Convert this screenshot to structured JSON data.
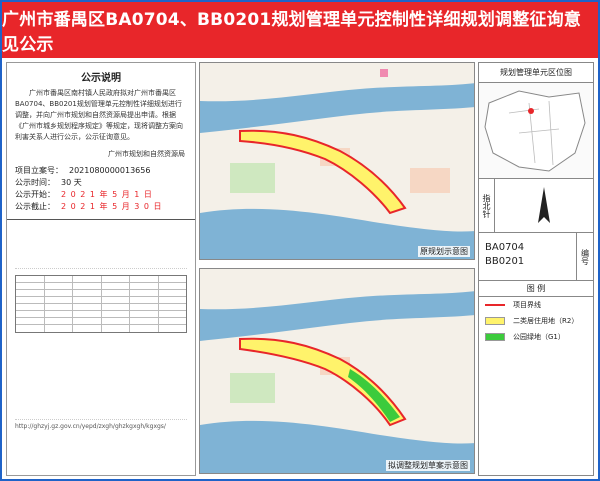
{
  "title": "广州市番禺区BA0704、BB0201规划管理单元控制性详细规划调整征询意见公示",
  "left": {
    "section_title": "公示说明",
    "notice": "广州市番禺区南村镇人民政府拟对广州市番禺区BA0704、BB0201规划管理单元控制性详细规划进行调整，并向广州市规划和自然资源局提出申请。根据《广州市城乡规划程序规定》等规定，现将调整方案向利害关系人进行公示，公示征询意见。",
    "org": "广州市规划和自然资源局",
    "project_no_label": "项目立案号：",
    "project_no": "2021080000013656",
    "period_label": "公示时间：",
    "period": "30 天",
    "start_label": "公示开始：",
    "start": "2 0 2 1 年 5 月 1 日",
    "end_label": "公示截止：",
    "end": "2 0 2 1 年 5 月 3 0 日",
    "url": "http://ghzyj.gz.gov.cn/yepd/zxgh/ghzkgxgh/kgxgs/"
  },
  "maps": {
    "top_caption": "原规划示意图",
    "bottom_caption": "拟调整规划草案示意图"
  },
  "right": {
    "location_title": "规划管理单元区位图",
    "compass_label": "指北针",
    "code_1": "BA0704",
    "code_2": "BB0201",
    "code_label": "编号",
    "legend_label": "图    例",
    "legend": [
      {
        "label": "项目界线",
        "color": "#e8262a"
      },
      {
        "label": "二类居住用地（R2）",
        "color": "#fff36b"
      },
      {
        "label": "公园绿地（G1）",
        "color": "#3ccb3c"
      }
    ]
  },
  "colors": {
    "title_bg": "#e8262a",
    "frame": "#1f63c8",
    "water": "#7fb3d5",
    "residential": "#fff36b",
    "green": "#3ccb3c",
    "boundary": "#e8262a"
  }
}
